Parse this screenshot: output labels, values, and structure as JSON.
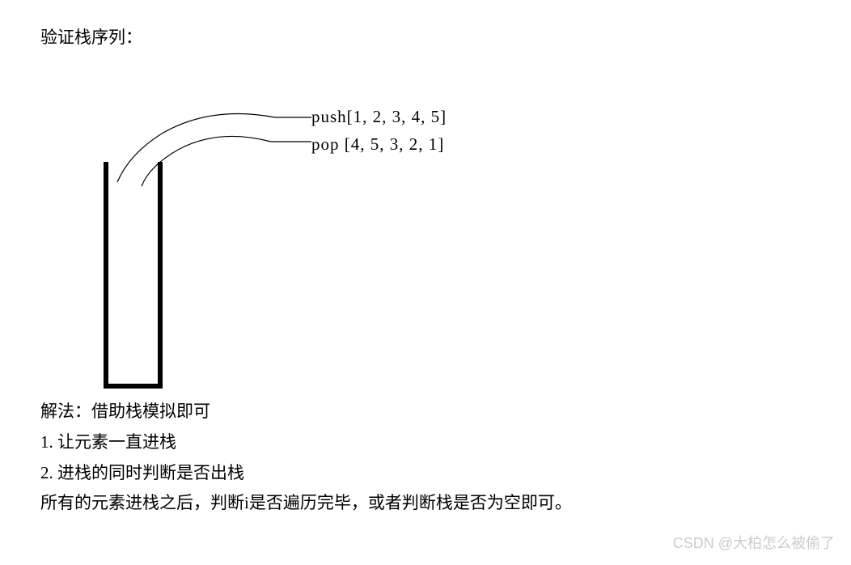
{
  "title": "验证栈序列：",
  "push_label": "push[1, 2, 3, 4, 5]",
  "pop_label": "pop  [4, 5, 3, 2, 1]",
  "solution": {
    "heading": "解法：借助栈模拟即可",
    "step1": "1. 让元素一直进栈",
    "step2": "2. 进栈的同时判断是否出栈",
    "conclusion": "所有的元素进栈之后，判断i是否遍历完毕，或者判断栈是否为空即可。"
  },
  "watermark": "CSDN @大柏怎么被偷了",
  "chart_data": {
    "type": "diagram",
    "description": "Stack validation sequence diagram",
    "stack_operations": {
      "push_sequence": [
        1,
        2,
        3,
        4,
        5
      ],
      "pop_sequence": [
        4,
        5,
        3,
        2,
        1
      ]
    },
    "visual_elements": [
      "U-shaped stack container",
      "Two curved arrows from stack opening to push/pop labels"
    ]
  }
}
